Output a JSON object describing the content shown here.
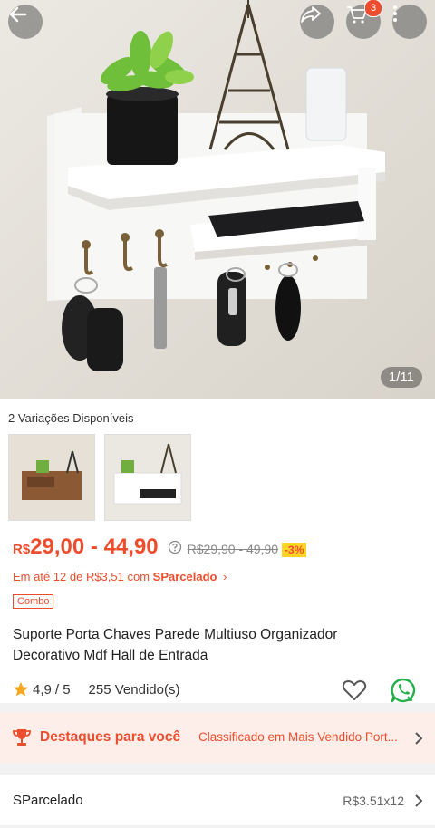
{
  "header": {
    "cart_count": "3",
    "image_counter": "1/11"
  },
  "variations": {
    "label": "2 Variações Disponíveis"
  },
  "price": {
    "currency": "R$",
    "range": "29,00 - 44,90",
    "original": "R$29,90 - 49,90",
    "discount": "-3%"
  },
  "installments": {
    "text_prefix": "Em até 12 de R$3,51 com ",
    "brand": "SParcelado",
    "chevron": "›"
  },
  "tag": "Combo",
  "product": {
    "title": "Suporte Porta Chaves Parede Multiuso Organizador Decorativo Mdf Hall de Entrada"
  },
  "rating": {
    "score": "4,9",
    "max": "/ 5",
    "sold": "255 Vendido(s)"
  },
  "highlights": {
    "label": "Destaques para você",
    "value": "Classificado em Mais Vendido Port..."
  },
  "sparcelado_row": {
    "label": "SParcelado",
    "value": "R$3.51x12"
  },
  "colors": {
    "accent": "#ee4d2d",
    "discount_bg": "#ffd424",
    "whatsapp": "#25b04b",
    "star": "#f5a623"
  },
  "icons": [
    "back-arrow-icon",
    "share-icon",
    "cart-icon",
    "more-icon",
    "help-icon",
    "heart-icon",
    "whatsapp-icon",
    "trophy-icon",
    "chevron-right-icon",
    "star-icon"
  ]
}
